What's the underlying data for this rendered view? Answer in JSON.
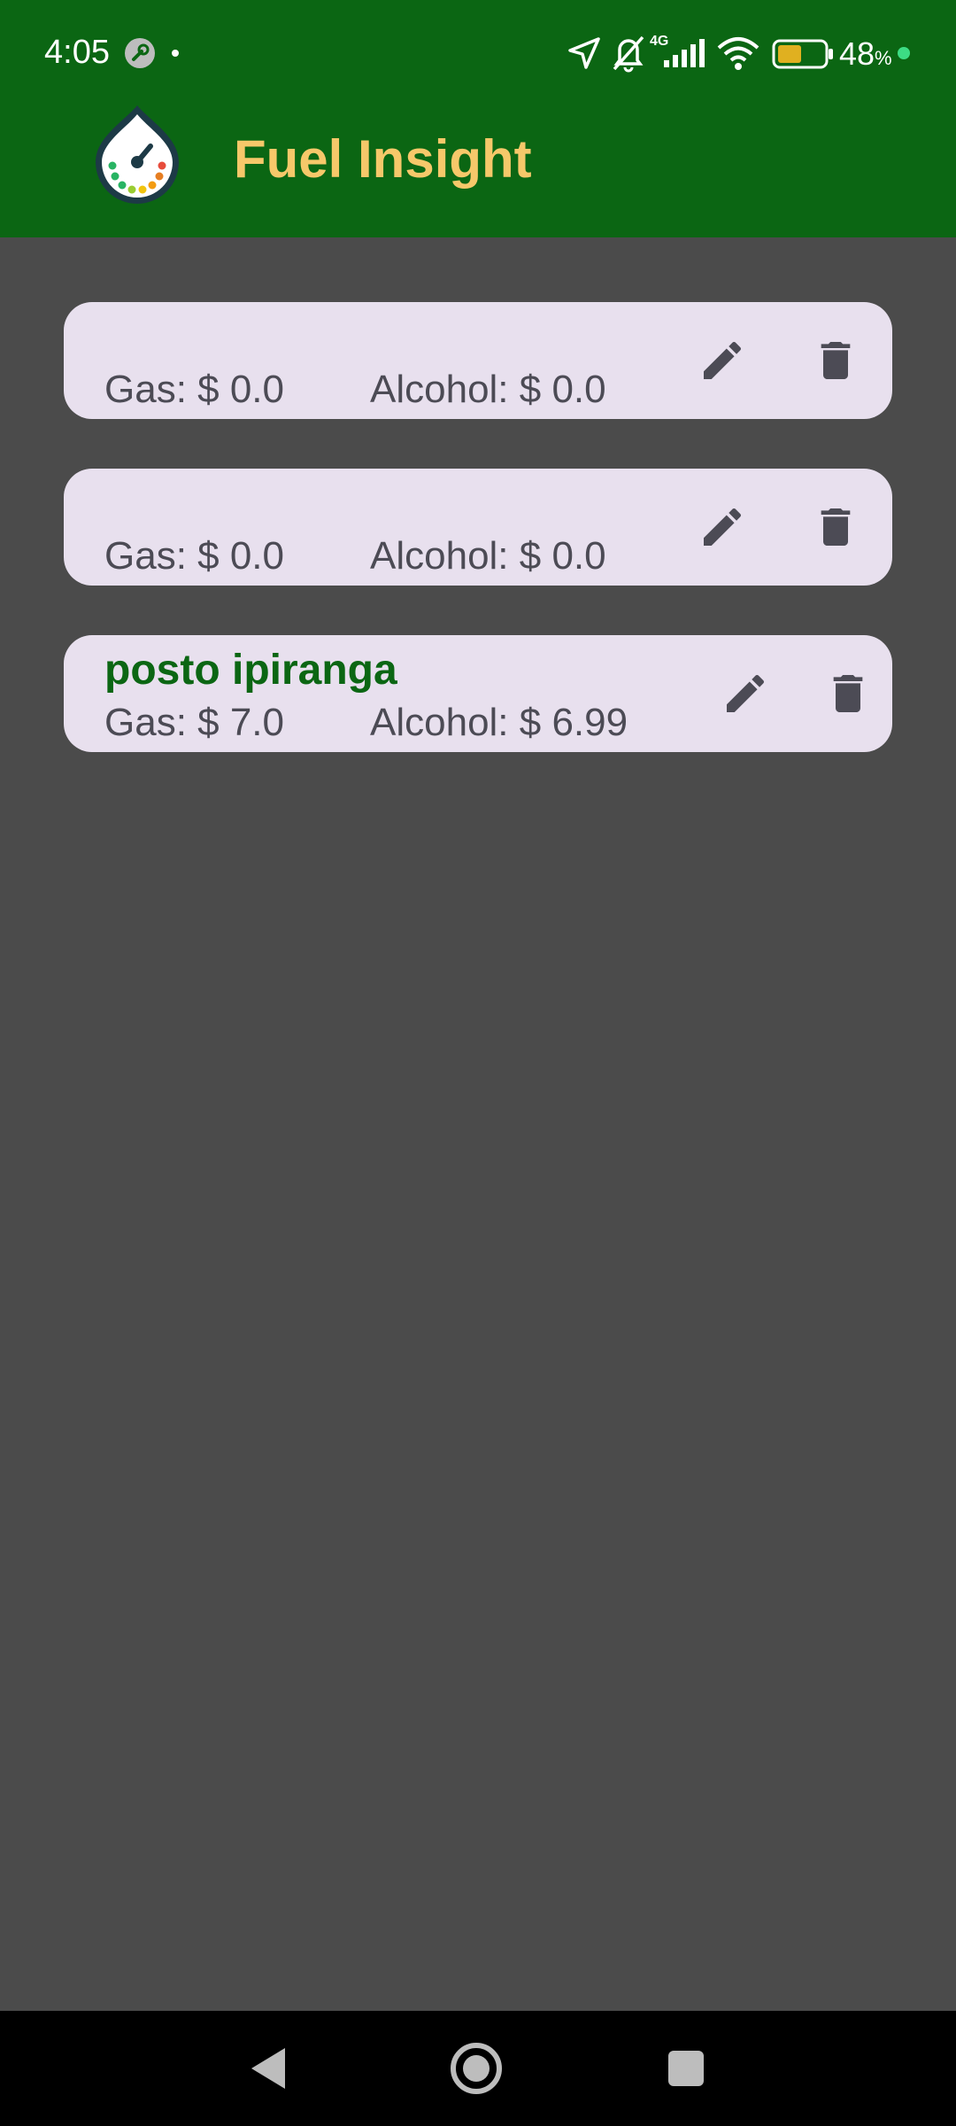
{
  "status_bar": {
    "time": "4:05",
    "network": "4G",
    "battery": "48",
    "battery_unit": "%",
    "icons": [
      "wrench-icon",
      "location-arrow-icon",
      "bell-off-icon",
      "signal-icon",
      "wifi-icon",
      "battery-icon"
    ]
  },
  "app_bar": {
    "title": "Fuel Insight",
    "logo_icon": "fuel-gauge-drop-icon",
    "background": "#0b6613",
    "title_color": "#f6c86a"
  },
  "stations": [
    {
      "name": "",
      "gas_label": "Gas: $ 0.0",
      "alcohol_label": "Alcohol: $ 0.0",
      "edit_icon": "pencil-icon",
      "delete_icon": "trash-icon"
    },
    {
      "name": "",
      "gas_label": "Gas: $ 0.0",
      "alcohol_label": "Alcohol: $ 0.0",
      "edit_icon": "pencil-icon",
      "delete_icon": "trash-icon"
    },
    {
      "name": "posto ipiranga",
      "gas_label": "Gas: $ 7.0",
      "alcohol_label": "Alcohol: $ 6.99",
      "edit_icon": "pencil-icon",
      "delete_icon": "trash-icon"
    }
  ],
  "nav_bar": {
    "buttons": [
      "back-icon",
      "home-icon",
      "recents-icon"
    ]
  },
  "colors": {
    "background": "#4b4b4b",
    "card": "#e8e0ee",
    "name_text": "#0b6613",
    "price_text": "#4c4b55"
  }
}
